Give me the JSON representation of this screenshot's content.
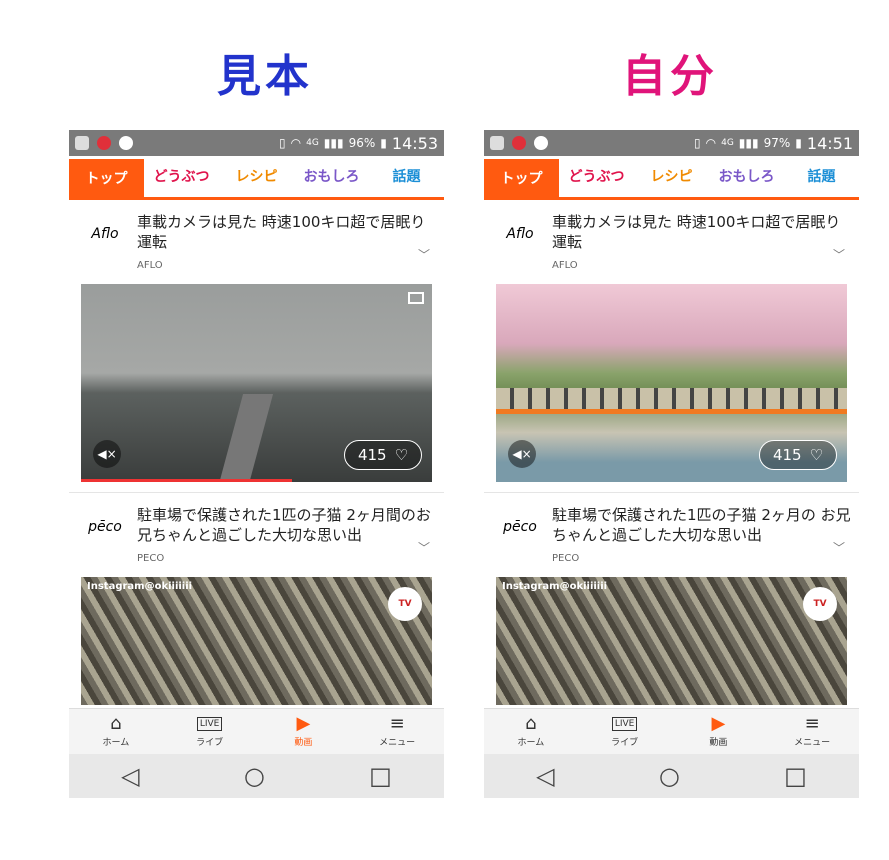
{
  "left": {
    "heading": "見本",
    "heading_color": "#2233cc",
    "status": {
      "battery": "96%",
      "time": "14:53",
      "network": "4G"
    },
    "tabs": [
      "トップ",
      "どうぶつ",
      "レシピ",
      "おもしろ",
      "話題"
    ],
    "tab_colors": [
      "#ffffff",
      "#e0144c",
      "#f08a00",
      "#7a57c8",
      "#1c8fd6"
    ],
    "articles": [
      {
        "logo": "Aflo",
        "title": "車載カメラは見た 時速100キロ超で居眠り運転",
        "source": "AFLO",
        "likes": "415"
      },
      {
        "logo": "pēco",
        "title": "駐車場で保護された1匹の子猫 2ヶ月間のお兄ちゃんと過ごした大切な思い出",
        "source": "PECO",
        "watermark": "Instagram@okiiiiiii"
      }
    ],
    "nav": [
      "ホーム",
      "ライブ",
      "動画",
      "メニュー"
    ]
  },
  "right": {
    "heading": "自分",
    "heading_color": "#e0147a",
    "status": {
      "battery": "97%",
      "time": "14:51",
      "network": "4G"
    },
    "tabs": [
      "トップ",
      "どうぶつ",
      "レシピ",
      "おもしろ",
      "話題"
    ],
    "tab_colors": [
      "#ffffff",
      "#e0144c",
      "#f08a00",
      "#7a57c8",
      "#1c8fd6"
    ],
    "articles": [
      {
        "logo": "Aflo",
        "title": "車載カメラは見た 時速100キロ超で居眠り運転",
        "source": "AFLO",
        "likes": "415"
      },
      {
        "logo": "pēco",
        "title": "駐車場で保護された1匹の子猫 2ヶ月の お兄ちゃんと過ごした大切な思い出",
        "source": "PECO",
        "watermark": "Instagram@okiiiiiii"
      }
    ],
    "nav": [
      "ホーム",
      "ライブ",
      "動画",
      "メニュー"
    ]
  },
  "icons": {
    "live_label": "LIVE",
    "tv_label": "TV"
  }
}
